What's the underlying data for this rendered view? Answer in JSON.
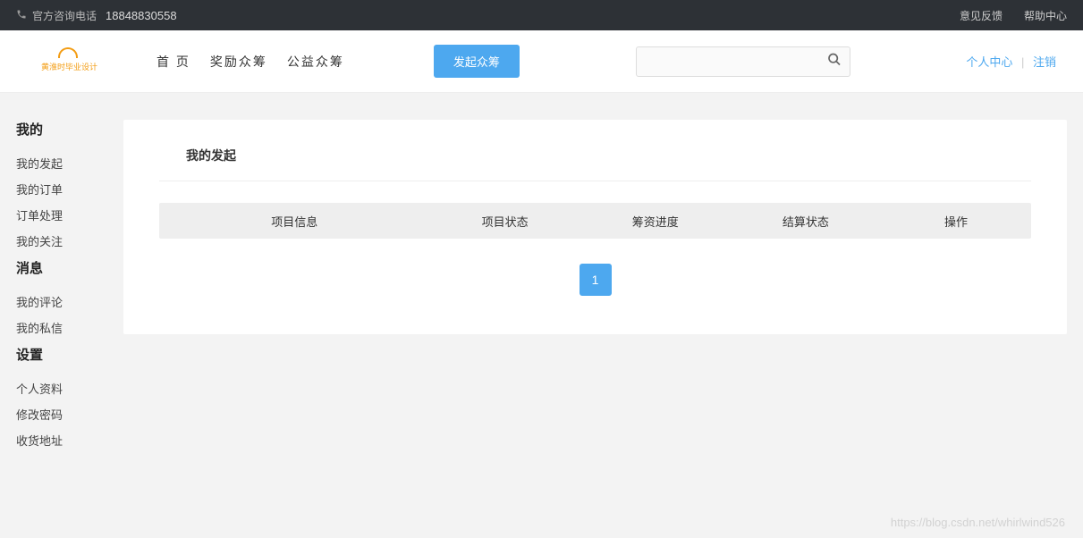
{
  "topbar": {
    "phone_label": "官方咨询电话",
    "phone_number": "18848830558",
    "feedback": "意见反馈",
    "help": "帮助中心"
  },
  "header": {
    "logo_text": "黄淮时毕业设计",
    "nav": {
      "home": "首  页",
      "reward": "奖励众筹",
      "charity": "公益众筹"
    },
    "launch": "发起众筹",
    "search_placeholder": "",
    "user_center": "个人中心",
    "logout": "注销"
  },
  "sidebar": {
    "sections": [
      {
        "title": "我的",
        "items": [
          {
            "label": "我的发起"
          },
          {
            "label": "我的订单"
          },
          {
            "label": "订单处理"
          },
          {
            "label": "我的关注"
          }
        ]
      },
      {
        "title": "消息",
        "items": [
          {
            "label": "我的评论"
          },
          {
            "label": "我的私信"
          }
        ]
      },
      {
        "title": "设置",
        "items": [
          {
            "label": "个人资料"
          },
          {
            "label": "修改密码"
          },
          {
            "label": "收货地址"
          }
        ]
      }
    ]
  },
  "main": {
    "title": "我的发起",
    "columns": {
      "info": "项目信息",
      "status": "项目状态",
      "progress": "筹资进度",
      "settle": "结算状态",
      "action": "操作"
    },
    "page": "1"
  },
  "watermark": "https://blog.csdn.net/whirlwind526"
}
